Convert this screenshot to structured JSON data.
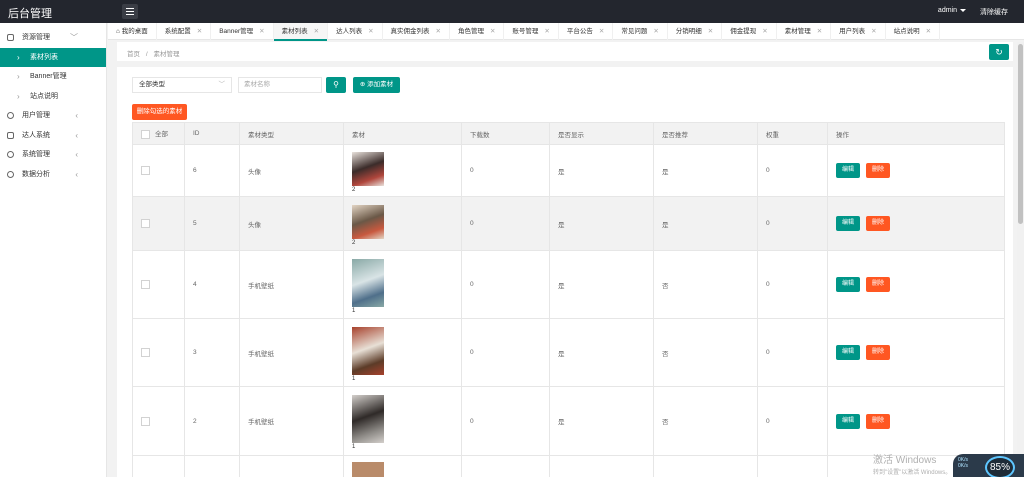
{
  "app": {
    "title": "后台管理"
  },
  "topbar": {
    "user": "admin",
    "clear_cache": "清除缓存"
  },
  "sidebar": {
    "items": [
      {
        "label": "资源管理",
        "arrow": "﹀"
      },
      {
        "label": "素材列表"
      },
      {
        "label": "Banner管理"
      },
      {
        "label": "站点说明"
      },
      {
        "label": "用户管理",
        "arrow": "‹"
      },
      {
        "label": "达人系统",
        "arrow": "‹"
      },
      {
        "label": "系统管理",
        "arrow": "‹"
      },
      {
        "label": "数据分析",
        "arrow": "‹"
      }
    ]
  },
  "tabs": [
    {
      "label": "我的桌面"
    },
    {
      "label": "系统配置"
    },
    {
      "label": "Banner管理"
    },
    {
      "label": "素材列表"
    },
    {
      "label": "达人列表"
    },
    {
      "label": "真实佣金列表"
    },
    {
      "label": "角色管理"
    },
    {
      "label": "账号管理"
    },
    {
      "label": "平台公告"
    },
    {
      "label": "常见问题"
    },
    {
      "label": "分销明细"
    },
    {
      "label": "佣金提现"
    },
    {
      "label": "素材管理"
    },
    {
      "label": "用户列表"
    },
    {
      "label": "站点说明"
    }
  ],
  "breadcrumb": {
    "home": "首页",
    "sep": "/",
    "current": "素材管理"
  },
  "toolbar": {
    "type_select": "全部类型",
    "search_placeholder": "素材名称",
    "add_label": "添加素材",
    "delete_selected_label": "删除勾选的素材"
  },
  "table": {
    "headers": {
      "all": "全部",
      "id": "ID",
      "type": "素材类型",
      "material": "素材",
      "downloads": "下载数",
      "home_show": "是否显示",
      "home_recommend": "是否推荐",
      "weight": "权重",
      "actions": "操作"
    },
    "edit_label": "编辑",
    "delete_label": "删除",
    "rows": [
      {
        "id": "6",
        "type": "头像",
        "count": "2",
        "downloads": "0",
        "show": "是",
        "recommend": "是",
        "weight": "0",
        "thumb_colors": [
          "#3b2c2a",
          "#e9e2dc",
          "#b0463c"
        ]
      },
      {
        "id": "5",
        "type": "头像",
        "count": "2",
        "downloads": "0",
        "show": "是",
        "recommend": "是",
        "weight": "0",
        "thumb_colors": [
          "#6a5847",
          "#e3d5c4",
          "#c8593f"
        ]
      },
      {
        "id": "4",
        "type": "手机壁纸",
        "count": "1",
        "downloads": "0",
        "show": "是",
        "recommend": "否",
        "weight": "0",
        "thumb_colors": [
          "#d9e4e6",
          "#89a9a6",
          "#4f6f8a"
        ]
      },
      {
        "id": "3",
        "type": "手机壁纸",
        "count": "1",
        "downloads": "0",
        "show": "是",
        "recommend": "否",
        "weight": "0",
        "thumb_colors": [
          "#e8e0d6",
          "#a7412c",
          "#5c3c28"
        ]
      },
      {
        "id": "2",
        "type": "手机壁纸",
        "count": "1",
        "downloads": "0",
        "show": "是",
        "recommend": "否",
        "weight": "0",
        "thumb_colors": [
          "#2f2a28",
          "#d4d0cc",
          "#8d8a86"
        ]
      }
    ]
  },
  "watermark": {
    "line1": "激活 Windows",
    "line2": "转到\"设置\"以激活 Windows。"
  },
  "system_widget": {
    "percent": "85%",
    "speed_up": "0K/s",
    "speed_down": "0K/s"
  },
  "colors": {
    "accent": "#009688",
    "danger": "#ff5722",
    "topbar": "#23262e"
  }
}
